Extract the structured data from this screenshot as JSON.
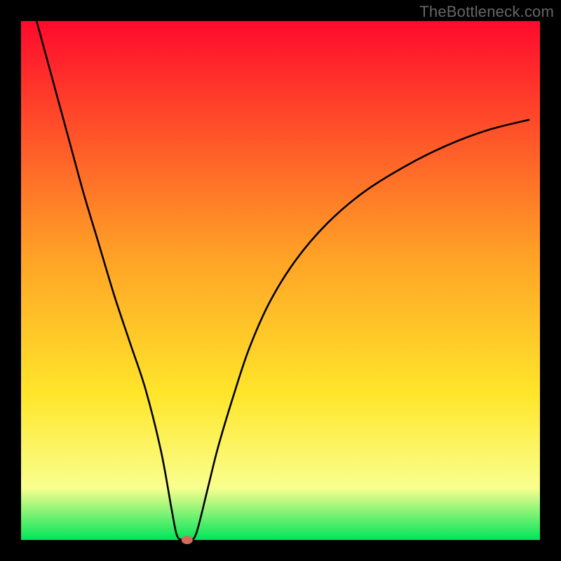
{
  "watermark": "TheBottleneck.com",
  "chart_data": {
    "type": "line",
    "title": "",
    "xlabel": "",
    "ylabel": "",
    "xlim": [
      0,
      100
    ],
    "ylim": [
      0,
      100
    ],
    "background_gradient": [
      "#ff0a2c",
      "#ffa126",
      "#ffe62a",
      "#f9ff8f",
      "#00e55a"
    ],
    "marker": {
      "x": 32,
      "y": 0,
      "color": "#d36a5e"
    },
    "x": [
      3,
      6,
      9,
      12,
      15,
      18,
      21,
      24,
      27,
      29,
      30,
      31,
      32,
      33,
      34,
      36,
      38,
      41,
      44,
      48,
      53,
      59,
      66,
      74,
      82,
      90,
      98
    ],
    "values": [
      100,
      89,
      78,
      67,
      57,
      47,
      38,
      29,
      17,
      6,
      1,
      0,
      0,
      0,
      2,
      10,
      18,
      28,
      37,
      46,
      54,
      61,
      67,
      72,
      76,
      79,
      81
    ],
    "series": [
      {
        "name": "bottleneck-curve",
        "color": "#000000"
      }
    ]
  }
}
